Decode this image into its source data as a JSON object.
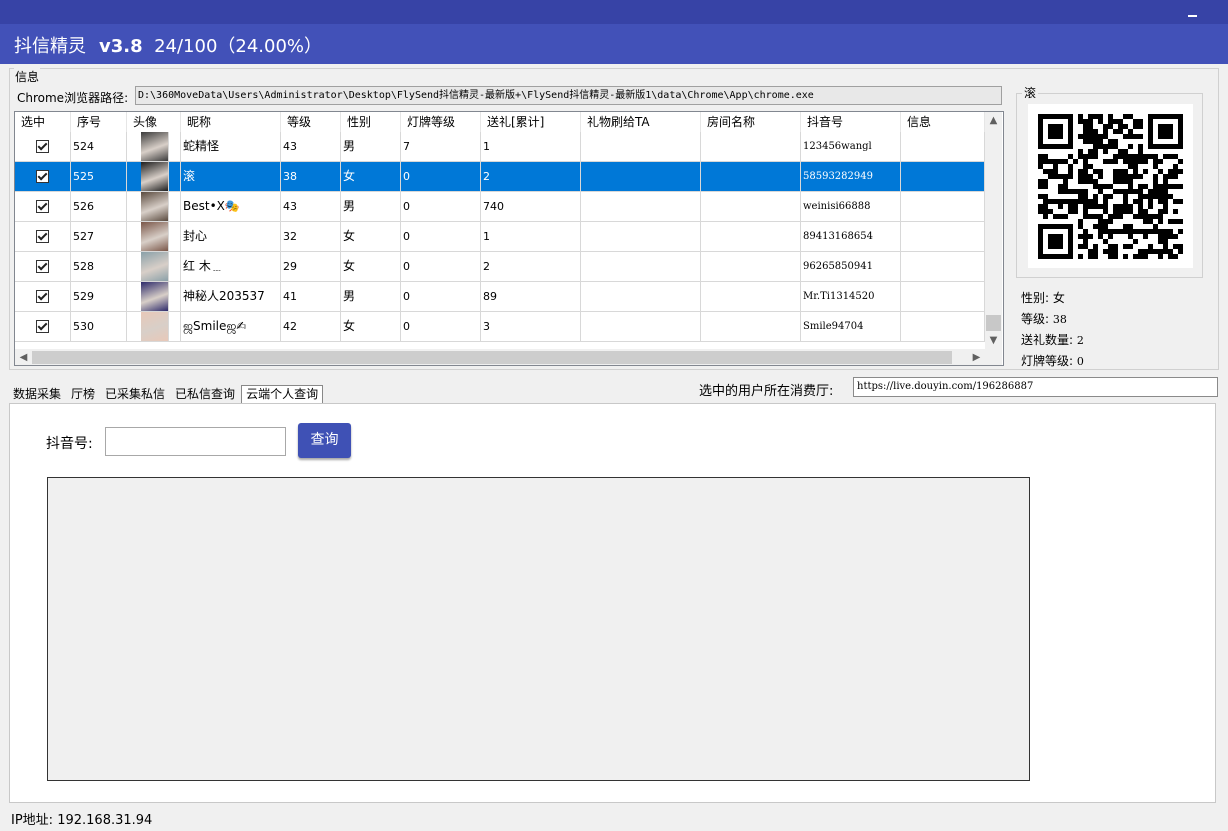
{
  "header": {
    "app_name": "抖信精灵",
    "version": "v3.8",
    "progress": "24/100（24.00%）"
  },
  "info": {
    "legend": "信息",
    "chrome_path_label": "Chrome浏览器路径:",
    "chrome_path": "D:\\360MoveData\\Users\\Administrator\\Desktop\\FlySend抖信精灵-最新版+\\FlySend抖信精灵-最新版1\\data\\Chrome\\App\\chrome.exe"
  },
  "table": {
    "headers": [
      "选中",
      "序号",
      "头像",
      "昵称",
      "等级",
      "性别",
      "灯牌等级",
      "送礼[累计]",
      "礼物刷给TA",
      "房间名称",
      "抖音号",
      "信息"
    ],
    "rows": [
      {
        "checked": true,
        "no": "524",
        "nick": "蛇精怪",
        "level": "43",
        "sex": "男",
        "fan": "7",
        "gift": "1",
        "ta": "",
        "room": "",
        "id": "123456wangl",
        "msg": "",
        "avatar_color": "#3a3a3a"
      },
      {
        "checked": true,
        "no": "525",
        "nick": "滚",
        "level": "38",
        "sex": "女",
        "fan": "0",
        "gift": "2",
        "ta": "",
        "room": "",
        "id": "58593282949",
        "msg": "",
        "avatar_color": "#1c1c1c"
      },
      {
        "checked": true,
        "no": "526",
        "nick": "Best•X🎭",
        "level": "43",
        "sex": "男",
        "fan": "0",
        "gift": "740",
        "ta": "",
        "room": "",
        "id": "weinisi66888",
        "msg": "",
        "avatar_color": "#5a4a3e"
      },
      {
        "checked": true,
        "no": "527",
        "nick": "封心",
        "level": "32",
        "sex": "女",
        "fan": "0",
        "gift": "1",
        "ta": "",
        "room": "",
        "id": "89413168654",
        "msg": "",
        "avatar_color": "#7a5648"
      },
      {
        "checked": true,
        "no": "528",
        "nick": "红 木﹍",
        "level": "29",
        "sex": "女",
        "fan": "0",
        "gift": "2",
        "ta": "",
        "room": "",
        "id": "96265850941",
        "msg": "",
        "avatar_color": "#8aa0a8"
      },
      {
        "checked": true,
        "no": "529",
        "nick": "神秘人203537",
        "level": "41",
        "sex": "男",
        "fan": "0",
        "gift": "89",
        "ta": "",
        "room": "",
        "id": "Mr.Ti1314520",
        "msg": "",
        "avatar_color": "#2d2a6a"
      },
      {
        "checked": true,
        "no": "530",
        "nick": "ஜSmileஜ✍",
        "level": "42",
        "sex": "女",
        "fan": "0",
        "gift": "3",
        "ta": "",
        "room": "",
        "id": "Smile94704",
        "msg": "",
        "avatar_color": "#e8c8b8"
      }
    ],
    "selected_index": 1
  },
  "side": {
    "name": "滚",
    "gender_label": "性别: ",
    "gender": "女",
    "level_label": "等级: ",
    "level": "38",
    "gift_label": "送礼数量: ",
    "gift": "2",
    "fan_label": "灯牌等级: ",
    "fan": "0"
  },
  "tabs": [
    "数据采集",
    "厅榜",
    "已采集私信",
    "已私信查询",
    "云端个人查询"
  ],
  "active_tab": 4,
  "room": {
    "label": "选中的用户所在消费厅:",
    "url": "https://live.douyin.com/196286887"
  },
  "query": {
    "label": "抖音号:",
    "input_value": "",
    "button": "查询"
  },
  "status": {
    "ip_label": "IP地址:",
    "ip": "192.168.31.94"
  },
  "colors": {
    "title_bar": "#3743a6",
    "header": "#4251b8",
    "selected_row": "#0078d7",
    "button": "#3f51b5"
  }
}
